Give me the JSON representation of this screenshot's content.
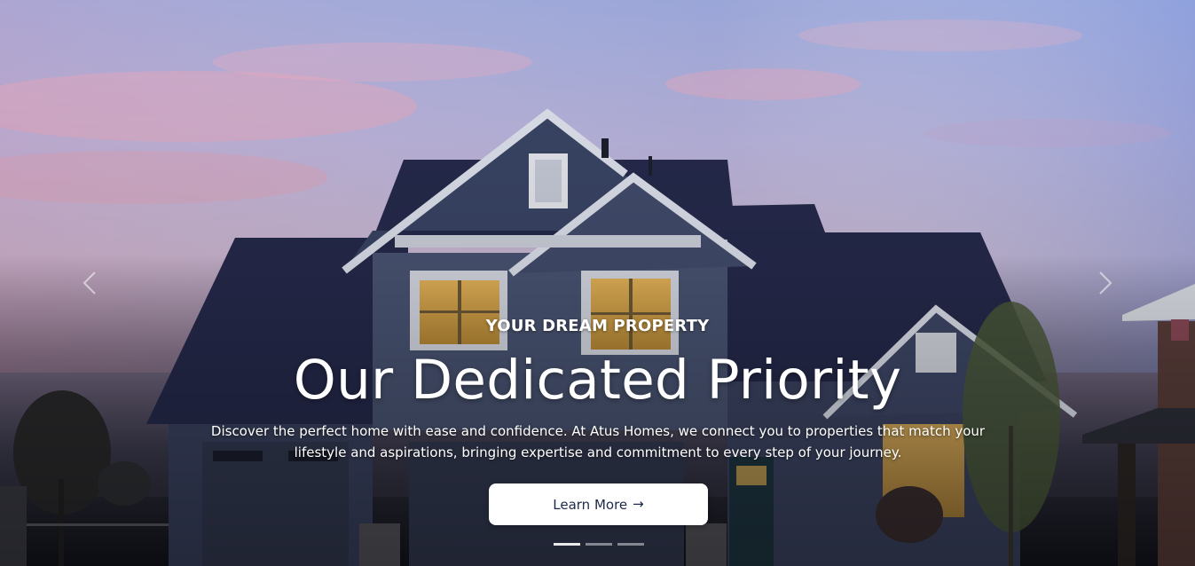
{
  "hero": {
    "background_image_description": "house-at-dusk-photo",
    "eyebrow": "YOUR DREAM PROPERTY",
    "headline": "Our Dedicated Priority",
    "description": "Discover the perfect home with ease and confidence. At Atus Homes, we connect you to properties that match your lifestyle and aspirations, bringing expertise and commitment to every step of your journey.",
    "cta": {
      "label": "Learn More",
      "icon": "arrow-right-icon",
      "arrow_glyph": "→"
    }
  },
  "carousel": {
    "prev_icon": "chevron-left-icon",
    "next_icon": "chevron-right-icon",
    "indicators": [
      {
        "active": true
      },
      {
        "active": false
      },
      {
        "active": false
      }
    ]
  },
  "colors": {
    "cta_background": "#ffffff",
    "cta_text": "#1d2a4a",
    "text": "#ffffff",
    "roof": "#262a4c",
    "siding": "#4b5674"
  }
}
